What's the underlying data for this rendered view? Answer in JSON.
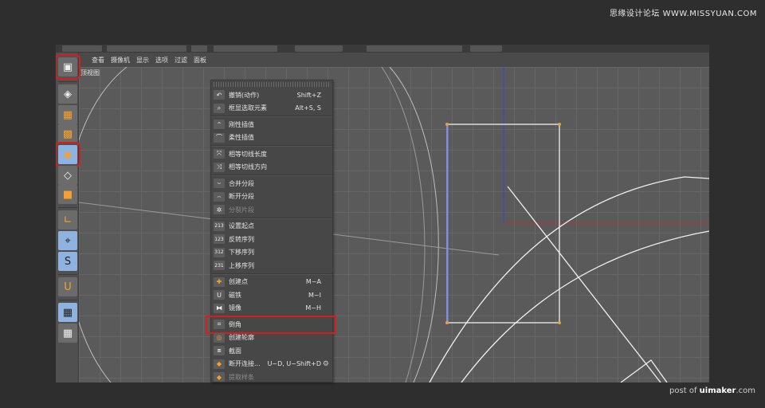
{
  "watermark": {
    "top": "思缘设计论坛 WWW.MISSYUAN.COM",
    "bottom_prefix": "post of ",
    "bottom_brand": "uimaker",
    "bottom_suffix": ".com"
  },
  "menubar": [
    "查看",
    "摄像机",
    "显示",
    "选项",
    "过滤",
    "面板"
  ],
  "viewport": {
    "label": "顶视图"
  },
  "toolbar": [
    {
      "name": "model-mode-icon",
      "glyph": "▣"
    },
    {
      "name": "points-mode-icon",
      "glyph": "◈"
    },
    {
      "name": "texture-mode-icon",
      "glyph": "▦"
    },
    {
      "name": "workplane-mode-icon",
      "glyph": "▩"
    },
    {
      "name": "points-edit-icon",
      "glyph": "◆"
    },
    {
      "name": "edges-edit-icon",
      "glyph": "◇"
    },
    {
      "name": "polygons-edit-icon",
      "glyph": "■"
    },
    {
      "name": "axis-icon",
      "glyph": "∟"
    },
    {
      "name": "tweak-icon",
      "glyph": "⌖"
    },
    {
      "name": "snap-icon",
      "glyph": "S"
    },
    {
      "name": "magnet-icon",
      "glyph": "U"
    },
    {
      "name": "workplane-lock-icon",
      "glyph": "▦"
    },
    {
      "name": "planar-workplane-icon",
      "glyph": "▦"
    }
  ],
  "context_menu": {
    "groups": [
      [
        {
          "label": "撤销(动作)",
          "shortcut": "Shift+Z",
          "icon": "undo-icon",
          "glyph": "↶"
        },
        {
          "label": "框显选取元素",
          "shortcut": "Alt+S, S",
          "icon": "frame-selected-icon",
          "glyph": "⌕"
        }
      ],
      [
        {
          "label": "刚性插值",
          "shortcut": "",
          "icon": "hard-interpolation-icon",
          "glyph": "⌃"
        },
        {
          "label": "柔性插值",
          "shortcut": "",
          "icon": "soft-interpolation-icon",
          "glyph": "⌒"
        }
      ],
      [
        {
          "label": "相等切线长度",
          "shortcut": "",
          "icon": "equal-tangent-length-icon",
          "glyph": "⤧"
        },
        {
          "label": "相等切线方向",
          "shortcut": "",
          "icon": "equal-tangent-direction-icon",
          "glyph": "⤨"
        }
      ],
      [
        {
          "label": "合并分段",
          "shortcut": "",
          "icon": "join-segment-icon",
          "glyph": "⌣"
        },
        {
          "label": "断开分段",
          "shortcut": "",
          "icon": "break-segment-icon",
          "glyph": "⌢"
        },
        {
          "label": "分裂片段",
          "shortcut": "",
          "icon": "explode-segments-icon",
          "glyph": "✲",
          "disabled": true
        }
      ],
      [
        {
          "label": "设置起点",
          "shortcut": "",
          "icon": "set-first-point-icon",
          "glyph": "213"
        },
        {
          "label": "反转序列",
          "shortcut": "",
          "icon": "reverse-sequence-icon",
          "glyph": "123"
        },
        {
          "label": "下移序列",
          "shortcut": "",
          "icon": "move-down-sequence-icon",
          "glyph": "312"
        },
        {
          "label": "上移序列",
          "shortcut": "",
          "icon": "move-up-sequence-icon",
          "glyph": "231"
        }
      ],
      [
        {
          "label": "创建点",
          "shortcut": "M~A",
          "icon": "create-point-icon",
          "glyph": "✚"
        },
        {
          "label": "磁铁",
          "shortcut": "M~I",
          "icon": "magnet-icon",
          "glyph": "U"
        },
        {
          "label": "镜像",
          "shortcut": "M~H",
          "icon": "mirror-icon",
          "glyph": "⧓"
        }
      ],
      [
        {
          "label": "倒角",
          "shortcut": "",
          "icon": "chamfer-icon",
          "glyph": "⌗",
          "highlight": true
        },
        {
          "label": "创建轮廓",
          "shortcut": "",
          "icon": "create-outline-icon",
          "glyph": "◎"
        },
        {
          "label": "截面",
          "shortcut": "",
          "icon": "cross-section-icon",
          "glyph": "⧈"
        },
        {
          "label": "断开连接...",
          "shortcut": "U~D, U~Shift+D",
          "icon": "disconnect-icon",
          "glyph": "◆",
          "gear": true
        },
        {
          "label": "提取样条",
          "shortcut": "",
          "icon": "extract-spline-icon",
          "glyph": "◆",
          "disabled": true
        }
      ]
    ]
  },
  "colors": {
    "highlight": "#d61e1e",
    "rect_stroke": "#f0f0f0",
    "point_handle": "#e8a33a",
    "axis_y": "#2f45d6",
    "axis_x": "#c42d2d",
    "active_tool": "#8fb3e0"
  }
}
